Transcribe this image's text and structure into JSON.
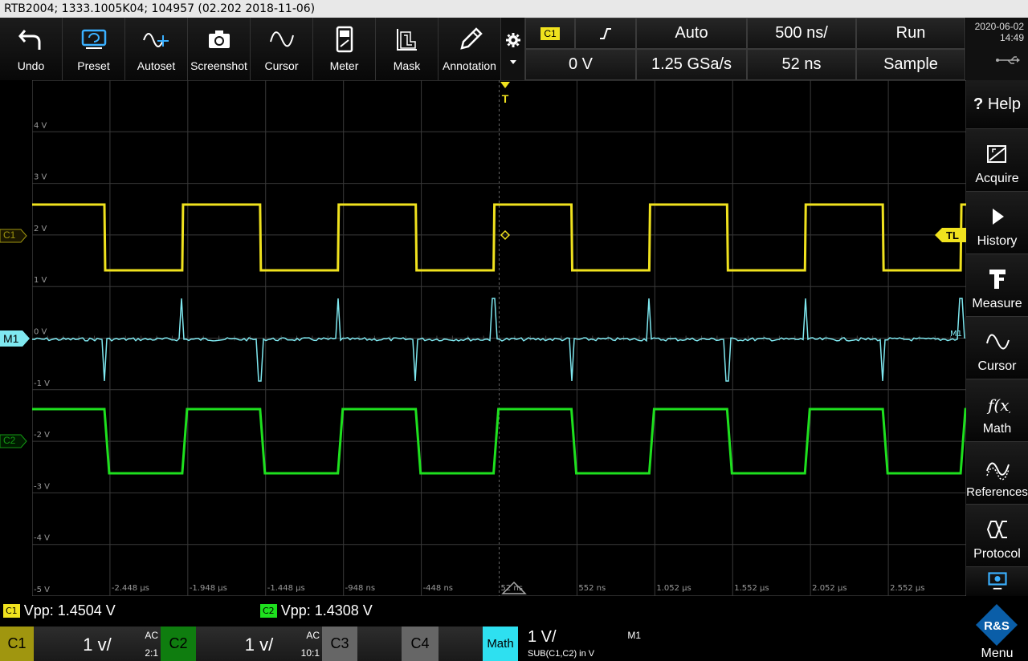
{
  "title": "RTB2004; 1333.1005K04; 104957 (02.202 2018-11-06)",
  "toolbar": [
    {
      "label": "Undo",
      "icon": "undo-icon"
    },
    {
      "label": "Preset",
      "icon": "preset-icon"
    },
    {
      "label": "Autoset",
      "icon": "autoset-icon"
    },
    {
      "label": "Screenshot",
      "icon": "camera-icon"
    },
    {
      "label": "Cursor",
      "icon": "cursor-icon"
    },
    {
      "label": "Meter",
      "icon": "meter-icon"
    },
    {
      "label": "Mask",
      "icon": "mask-icon"
    },
    {
      "label": "Annotation",
      "icon": "pencil-icon"
    }
  ],
  "settings": {
    "trigger_source": "C1",
    "trigger_level": "0 V",
    "trigger_mode": "Auto",
    "sample_rate": "1.25 GSa/s",
    "timebase": "500 ns/",
    "position": "52 ns",
    "run_state": "Run",
    "acq_mode": "Sample"
  },
  "datetime": {
    "date": "2020-06-02",
    "time": "14:49"
  },
  "sidebar": [
    {
      "label": "Help",
      "prefix": "?",
      "icon": "help-icon"
    },
    {
      "label": "Acquire",
      "icon": "acquire-icon"
    },
    {
      "label": "History",
      "icon": "play-icon"
    },
    {
      "label": "Measure",
      "icon": "measure-icon"
    },
    {
      "label": "Cursor",
      "icon": "cursor-icon"
    },
    {
      "label": "Math",
      "icon": "fx-icon"
    },
    {
      "label": "References",
      "icon": "references-icon"
    },
    {
      "label": "Protocol",
      "icon": "protocol-icon"
    },
    {
      "label": "",
      "icon": "display-icon"
    }
  ],
  "menu": {
    "label": "Menu",
    "icon": "rs-logo-icon"
  },
  "waveform": {
    "ylabels": [
      "4 V",
      "3 V",
      "2 V",
      "1 V",
      "0 V",
      "-1 V",
      "-2 V",
      "-3 V",
      "-4 V",
      "-5 V"
    ],
    "xlabels": [
      "-2.448 µs",
      "-1.948 µs",
      "-1.448 µs",
      "-948 ns",
      "-448 ns",
      "52 ns",
      "552 ns",
      "1.052 µs",
      "1.552 µs",
      "2.052 µs",
      "2.552 µs"
    ],
    "trigger_marker": "T",
    "trigger_level_tag": "TL",
    "channel_tags": {
      "c1": "C1",
      "m1": "M1",
      "c2": "C2"
    },
    "m1_right_tag": "M1",
    "colors": {
      "c1": "#f0e21e",
      "c2": "#1ee01e",
      "m1": "#7fe8f0",
      "grid": "#3a3a3a"
    }
  },
  "measurements": [
    {
      "tag": "C1",
      "text": "Vpp: 1.4504 V",
      "color": "#f0e21e"
    },
    {
      "tag": "C2",
      "text": "Vpp: 1.4308 V",
      "color": "#1ee01e"
    }
  ],
  "channels": [
    {
      "name": "C1",
      "scale": "1 v/",
      "coupling": "AC",
      "probe": "2:1"
    },
    {
      "name": "C2",
      "scale": "1 v/",
      "coupling": "AC",
      "probe": "10:1"
    },
    {
      "name": "C3"
    },
    {
      "name": "C4"
    },
    {
      "name": "Math",
      "scale": "1 V/",
      "source": "M1",
      "expr": "SUB(C1,C2) in V"
    }
  ]
}
